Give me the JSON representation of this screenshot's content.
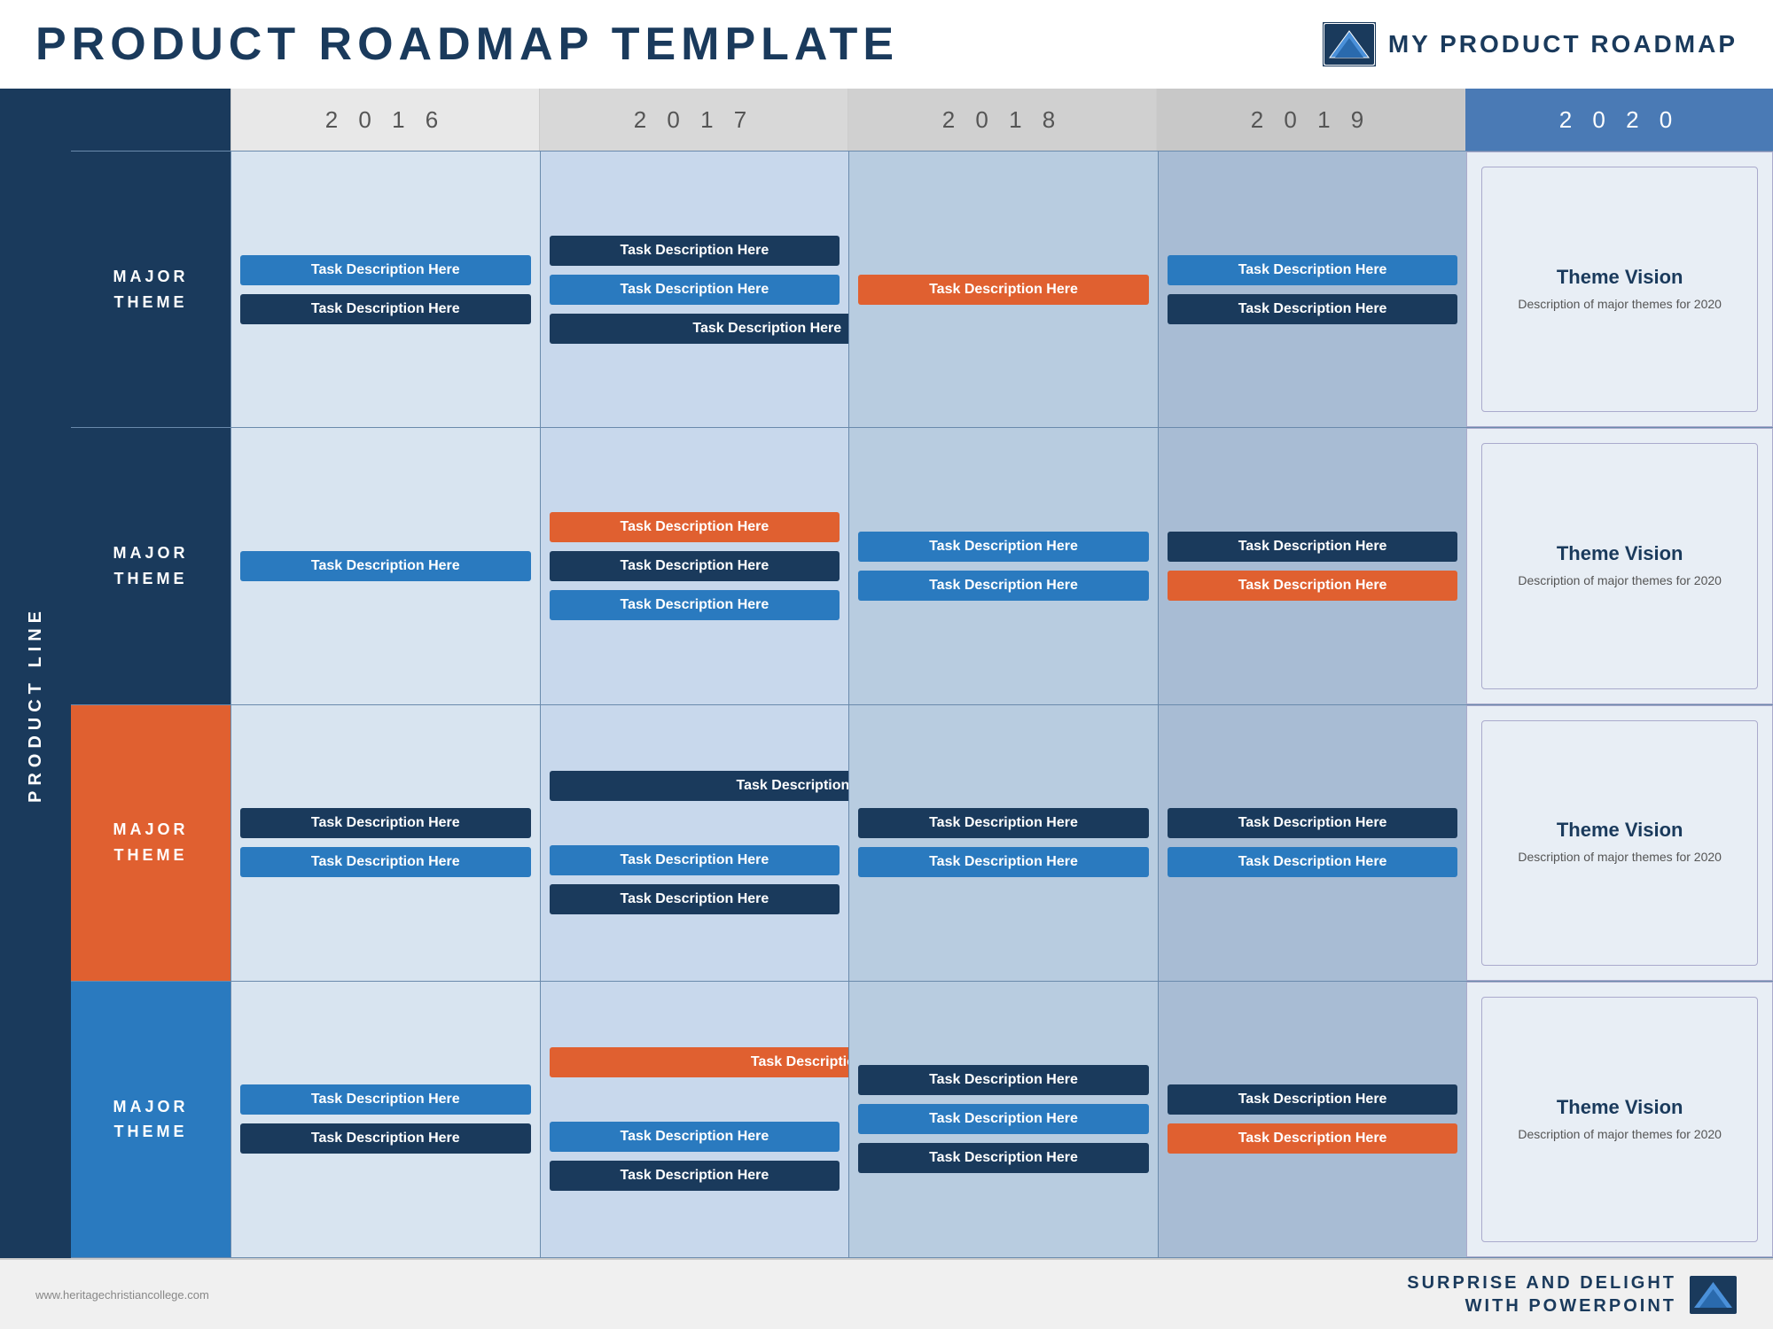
{
  "header": {
    "title": "PRODUCT ROADMAP TEMPLATE",
    "brand": "MY PRODUCT ROADMAP"
  },
  "years": [
    "2016",
    "2017",
    "2018",
    "2019",
    "2020"
  ],
  "product_line_label": "PRODUCT LINE",
  "rows": [
    {
      "label": [
        "MAJOR",
        "THEME"
      ],
      "color": "dark-blue",
      "cols": {
        "2016": [
          {
            "text": "Task Description Here",
            "color": "blue-medium",
            "align": "center"
          },
          {
            "text": "Task Description Here",
            "color": "blue-dark",
            "align": "left"
          }
        ],
        "2017": [
          {
            "text": "Task Description Here",
            "color": "blue-dark",
            "align": "center"
          },
          {
            "text": "Task Description Here",
            "color": "blue-medium",
            "align": "center"
          },
          {
            "text": "Task Description Here",
            "color": "blue-dark",
            "align": "center"
          }
        ],
        "2018": [
          {
            "text": "Task Description Here",
            "color": "orange",
            "align": "center"
          }
        ],
        "2019": [
          {
            "text": "Task Description Here",
            "color": "blue-medium",
            "align": "center"
          },
          {
            "text": "Task Description Here",
            "color": "blue-dark",
            "align": "center"
          }
        ],
        "2020": {
          "title": "Theme Vision",
          "desc": "Description of major themes for 2020"
        }
      }
    },
    {
      "label": [
        "MAJOR",
        "THEME"
      ],
      "color": "dark-blue",
      "cols": {
        "2016": [
          {
            "text": "Task Description Here",
            "color": "blue-medium",
            "align": "center"
          }
        ],
        "2017": [
          {
            "text": "Task Description Here",
            "color": "orange",
            "align": "center"
          },
          {
            "text": "Task Description Here",
            "color": "blue-dark",
            "align": "center"
          },
          {
            "text": "Task Description Here",
            "color": "blue-medium",
            "align": "center"
          }
        ],
        "2018": [
          {
            "text": "Task Description Here",
            "color": "blue-medium",
            "align": "center"
          },
          {
            "text": "Task Description Here",
            "color": "blue-medium",
            "align": "center"
          }
        ],
        "2019": [
          {
            "text": "Task Description Here",
            "color": "blue-dark",
            "align": "center"
          },
          {
            "text": "Task Description Here",
            "color": "orange",
            "align": "center"
          }
        ],
        "2020": {
          "title": "Theme Vision",
          "desc": "Description of major themes for 2020"
        }
      }
    },
    {
      "label": [
        "MAJOR",
        "THEME"
      ],
      "color": "orange",
      "cols": {
        "2016": [
          {
            "text": "Task Description Here",
            "color": "blue-dark",
            "align": "center"
          },
          {
            "text": "Task Description Here",
            "color": "blue-medium",
            "align": "center"
          }
        ],
        "2017": [
          {
            "text": "Task Description Here",
            "color": "blue-medium",
            "align": "center"
          },
          {
            "text": "Task Description Here",
            "color": "blue-dark",
            "align": "center"
          }
        ],
        "2018": [
          {
            "text": "Task Description Here",
            "color": "blue-dark",
            "align": "center"
          },
          {
            "text": "Task Description Here",
            "color": "blue-medium",
            "align": "center"
          }
        ],
        "2019": [
          {
            "text": "Task Description Here",
            "color": "blue-dark",
            "align": "center"
          },
          {
            "text": "Task Description Here",
            "color": "blue-medium",
            "align": "center"
          }
        ],
        "2020": {
          "title": "Theme Vision",
          "desc": "Description of major themes for 2020"
        }
      }
    },
    {
      "label": [
        "MAJOR",
        "THEME"
      ],
      "color": "light-blue",
      "cols": {
        "2016": [
          {
            "text": "Task Description Here",
            "color": "blue-medium",
            "align": "center"
          },
          {
            "text": "Task Description Here",
            "color": "blue-dark",
            "align": "center"
          }
        ],
        "2017": [
          {
            "text": "Task Description Here",
            "color": "orange",
            "align": "center"
          },
          {
            "text": "Task Description Here",
            "color": "blue-medium",
            "align": "center"
          }
        ],
        "2018": [
          {
            "text": "Task Description Here",
            "color": "blue-dark",
            "align": "center"
          },
          {
            "text": "Task Description Here",
            "color": "blue-medium",
            "align": "center"
          },
          {
            "text": "Task Description Here",
            "color": "blue-dark",
            "align": "center"
          }
        ],
        "2019": [
          {
            "text": "Task Description Here",
            "color": "blue-dark",
            "align": "center"
          },
          {
            "text": "Task Description Here",
            "color": "orange",
            "align": "center"
          }
        ],
        "2020": {
          "title": "Theme Vision",
          "desc": "Description of major themes for 2020"
        }
      }
    }
  ],
  "footer": {
    "left": "www.heritagechristiancollege.com",
    "right_line1": "SURPRISE AND DELIGHT",
    "right_line2": "WITH POWERPOINT"
  }
}
